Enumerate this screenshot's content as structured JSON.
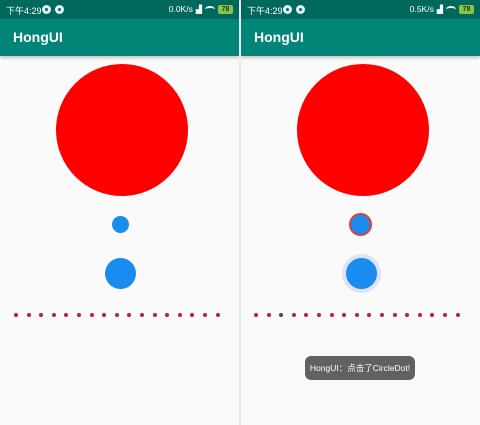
{
  "screens": [
    {
      "status_bar": {
        "time": "下午4:29",
        "speed": "0.0K/s",
        "battery": "78"
      },
      "app_bar": {
        "title": "HongUI"
      },
      "dots": {
        "count": 17,
        "active_index": null
      },
      "toast": null
    },
    {
      "status_bar": {
        "time": "下午4:29",
        "speed": "0.5K/s",
        "battery": "78"
      },
      "app_bar": {
        "title": "HongUI"
      },
      "dots": {
        "count": 17,
        "active_index": 2
      },
      "toast": {
        "text": "HongUI：点击了CircleDot!"
      }
    }
  ],
  "colors": {
    "status_bar": "#00695c",
    "app_bar": "#008577",
    "big_circle": "#ff0000",
    "blue_dot": "#1a8cf0",
    "row_dot": "#c2185b",
    "selected_ring": "#e53935"
  },
  "icons": [
    "notification-dot-icon",
    "wifi-icon",
    "signal-icon",
    "battery-icon"
  ]
}
